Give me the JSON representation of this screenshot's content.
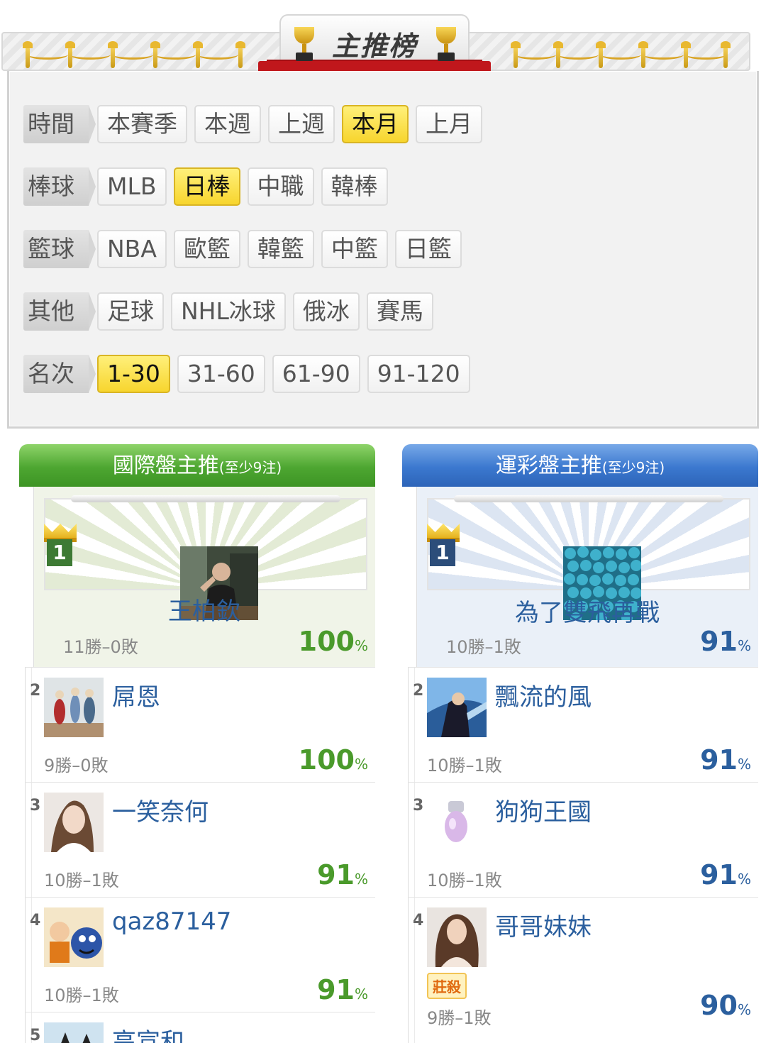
{
  "banner": {
    "title": "主推榜"
  },
  "filters": {
    "rows": [
      {
        "label": "時間",
        "options": [
          "本賽季",
          "本週",
          "上週",
          "本月",
          "上月"
        ],
        "active": "本月"
      },
      {
        "label": "棒球",
        "options": [
          "MLB",
          "日棒",
          "中職",
          "韓棒"
        ],
        "active": "日棒"
      },
      {
        "label": "籃球",
        "options": [
          "NBA",
          "歐籃",
          "韓籃",
          "中籃",
          "日籃"
        ],
        "active": null
      },
      {
        "label": "其他",
        "options": [
          "足球",
          "NHL冰球",
          "俄冰",
          "賽馬"
        ],
        "active": null
      },
      {
        "label": "名次",
        "options": [
          "1-30",
          "31-60",
          "61-90",
          "91-120"
        ],
        "active": "1-30"
      }
    ]
  },
  "left": {
    "title": "國際盤主推",
    "note": "(至少9注)",
    "first": {
      "rank": "1",
      "name": "王柏欽",
      "record": "11勝–0敗",
      "pct": "100",
      "pct_unit": "%"
    },
    "entries": [
      {
        "rank": "2",
        "name": "屌恩",
        "record": "9勝–0敗",
        "pct": "100",
        "pct_unit": "%"
      },
      {
        "rank": "3",
        "name": "一笑奈何",
        "record": "10勝–1敗",
        "pct": "91",
        "pct_unit": "%"
      },
      {
        "rank": "4",
        "name": "qaz87147",
        "record": "10勝–1敗",
        "pct": "91",
        "pct_unit": "%"
      },
      {
        "rank": "5",
        "name": "高宣和"
      }
    ]
  },
  "right": {
    "title": "運彩盤主推",
    "note": "(至少9注)",
    "first": {
      "rank": "1",
      "name": "為了雙飛再戰",
      "record": "10勝–1敗",
      "pct": "91",
      "pct_unit": "%"
    },
    "entries": [
      {
        "rank": "2",
        "name": "飄流的風",
        "record": "10勝–1敗",
        "pct": "91",
        "pct_unit": "%"
      },
      {
        "rank": "3",
        "name": "狗狗王國",
        "record": "10勝–1敗",
        "pct": "91",
        "pct_unit": "%"
      },
      {
        "rank": "4",
        "name": "哥哥妹妹",
        "tag": "莊殺",
        "record": "9勝–1敗",
        "pct": "90",
        "pct_unit": "%"
      }
    ]
  },
  "colors": {
    "active": "#f7d52e",
    "green": "#4a9a2b",
    "blue": "#2b5f9e"
  }
}
